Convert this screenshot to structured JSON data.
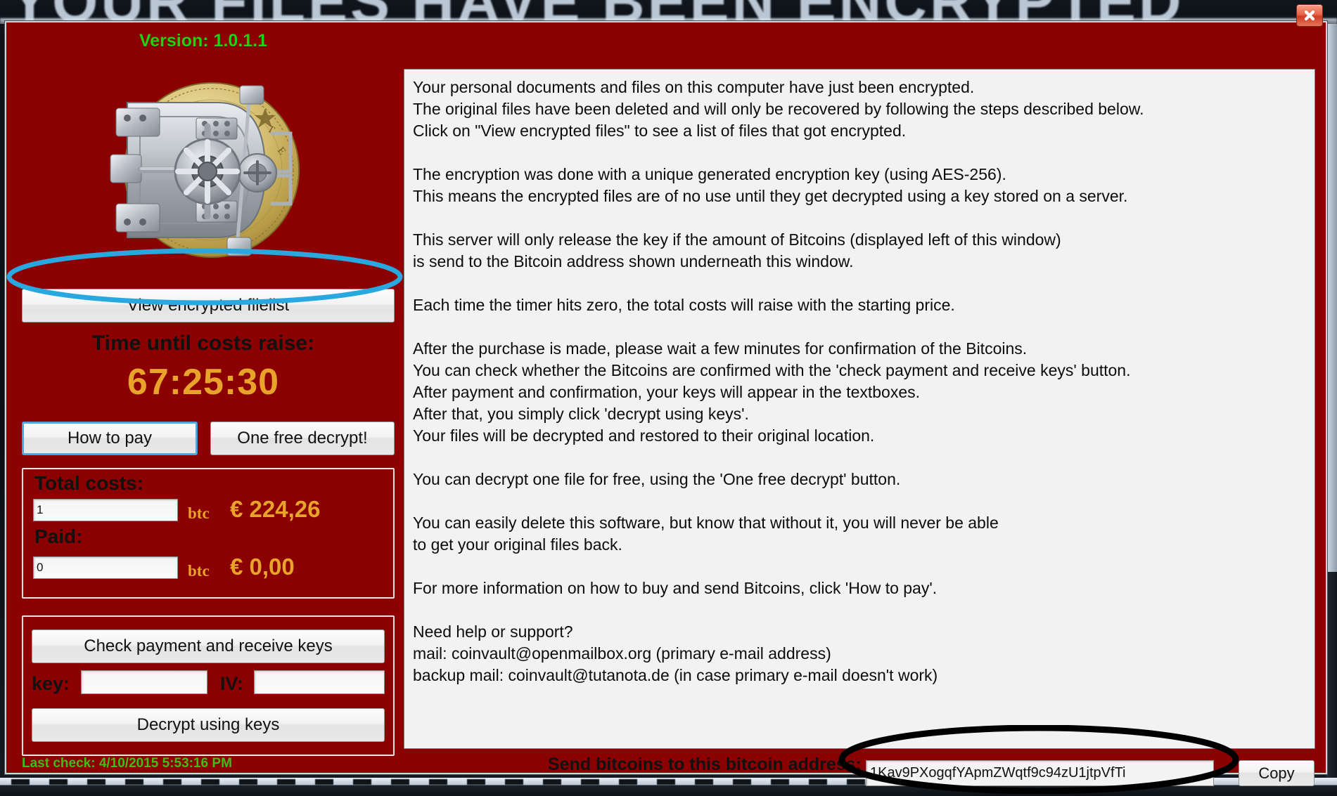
{
  "window": {
    "behind_banner_text": "YOUR FILES HAVE BEEN ENCRYPTED",
    "close_label": "Close",
    "background_color": "#8b0000"
  },
  "left_panel": {
    "version": "Version: 1.0.1.1",
    "vault_icon": "bank-vault-door-over-gold-bitcoin",
    "view_filelist_label": "View encrypted filelist",
    "timer_label": "Time until costs raise:",
    "timer_value": "67:25:30",
    "timer_color": "#e8a32a",
    "how_to_pay_label": "How to pay",
    "one_free_decrypt_label": "One free decrypt!",
    "costs": {
      "total_label": "Total costs:",
      "total_btc_value": "1",
      "total_btc_unit": "btc",
      "total_eur": "€ 224,26",
      "paid_label": "Paid:",
      "paid_btc_value": "0",
      "paid_btc_unit": "btc",
      "paid_eur": "€ 0,00"
    },
    "keys": {
      "check_payment_label": "Check payment and receive keys",
      "key_label": "key:",
      "key_value": "",
      "iv_label": "IV:",
      "iv_value": "",
      "decrypt_label": "Decrypt using keys"
    },
    "last_check": "Last check: 4/10/2015 5:53:16 PM",
    "last_check_color": "#3fbe17",
    "version_color": "#22d10f"
  },
  "message": {
    "body": "Your personal documents and files on this computer have just been encrypted.\nThe original files have been deleted and will only be recovered by following the steps described below.\nClick on \"View encrypted files\" to see a list of files that got encrypted.\n\nThe encryption was done with a unique generated encryption key (using AES-256).\nThis means the encrypted files are of no use until they get decrypted using a key stored on a server.\n\nThis server will only release the key if the amount of Bitcoins (displayed left of this window)\nis send to the Bitcoin address shown underneath this window.\n\nEach time the timer hits zero, the total costs will raise with the starting price.\n\nAfter the purchase is made, please wait a few minutes for confirmation of the Bitcoins.\nYou can check whether the Bitcoins are confirmed with the 'check payment and receive keys' button.\nAfter payment and confirmation, your keys will appear in the textboxes.\nAfter that, you simply click 'decrypt using keys'.\nYour files will be decrypted and restored to their original location.\n\nYou can decrypt one file for free, using the 'One free decrypt' button.\n\nYou can easily delete this software, but know that without it, you will never be able\nto get your original files back.\n\nFor more information on how to buy and send Bitcoins, click 'How to pay'.\n\nNeed help or support?\nmail: coinvault@openmailbox.org (primary e-mail address)\nbackup mail: coinvault@tutanota.de (in case primary e-mail doesn't work)"
  },
  "bottom_bar": {
    "send_label": "Send bitcoins to this bitcoin address:",
    "address_value": "1Kav9PXogqfYApmZWqtf9c94zU1jtpVfTi",
    "copy_label": "Copy"
  },
  "annotations": {
    "blue_ellipse_target": "view-encrypted-filelist-button",
    "blue_color": "#29a8e0",
    "black_ellipse_target": "bitcoin-address-field",
    "black_color": "#000000"
  }
}
